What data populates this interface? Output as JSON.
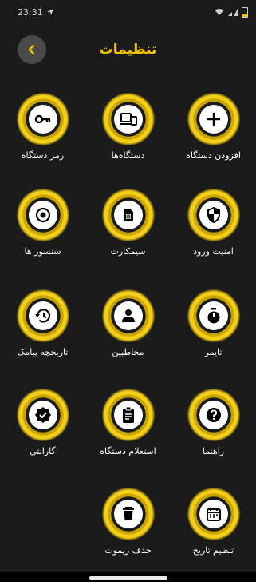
{
  "status_bar": {
    "time": "23:31"
  },
  "header": {
    "title": "تنظیمات"
  },
  "items": [
    {
      "label": "افزودن دستگاه",
      "icon": "plus-icon"
    },
    {
      "label": "دستگاه‌ها",
      "icon": "devices-icon"
    },
    {
      "label": "رمز دستگاه",
      "icon": "key-icon"
    },
    {
      "label": "امنیت ورود",
      "icon": "shield-icon"
    },
    {
      "label": "سیمکارت",
      "icon": "sim-card-icon"
    },
    {
      "label": "سنسور ها",
      "icon": "sensor-icon"
    },
    {
      "label": "تایمر",
      "icon": "timer-icon"
    },
    {
      "label": "مخاطبین",
      "icon": "contacts-icon"
    },
    {
      "label": "تاریخچه پیامک",
      "icon": "history-icon"
    },
    {
      "label": "راهنما",
      "icon": "help-icon"
    },
    {
      "label": "استعلام دستگاه",
      "icon": "clipboard-icon"
    },
    {
      "label": "گارانتی",
      "icon": "verified-icon"
    },
    {
      "label": "تنظیم تاریخ",
      "icon": "calendar-icon"
    },
    {
      "label": "حذف ریموت",
      "icon": "trash-icon"
    }
  ],
  "colors": {
    "accent": "#f2c400",
    "background": "#1b1b1b",
    "icon_fill": "#000000"
  }
}
